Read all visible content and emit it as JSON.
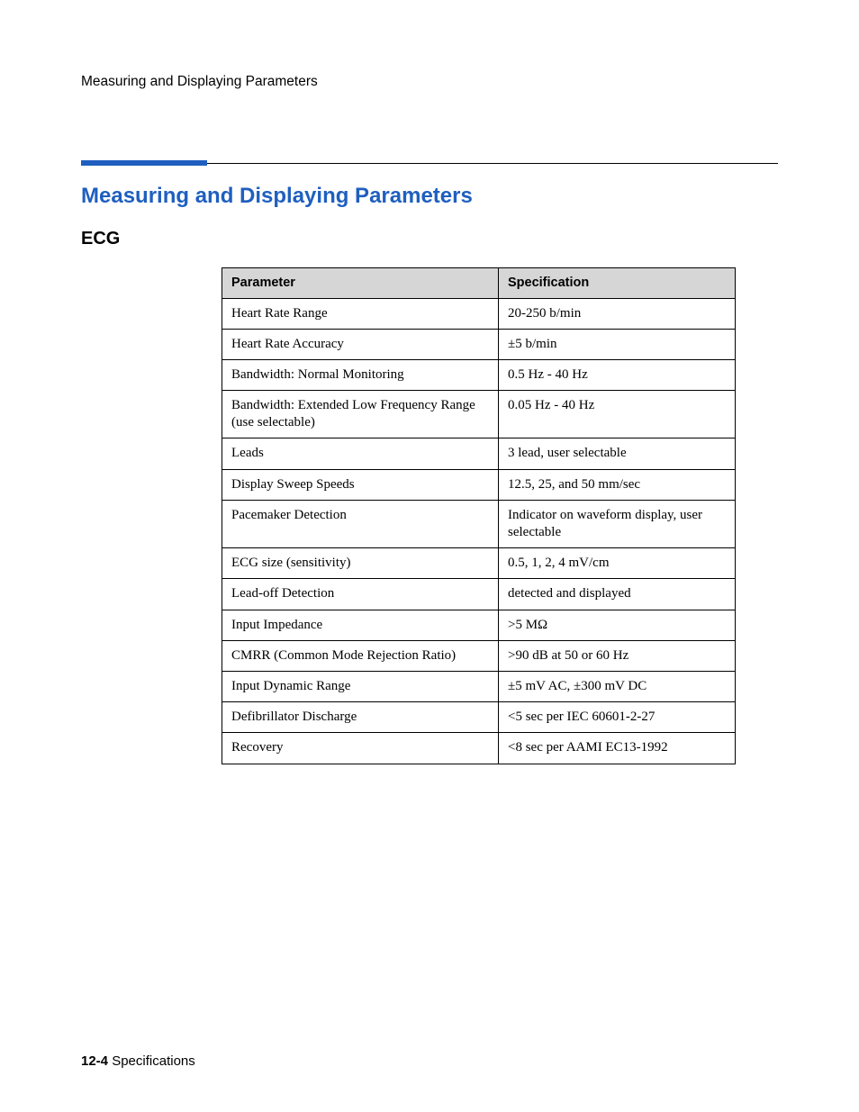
{
  "runningHeader": "Measuring and Displaying Parameters",
  "sectionHeading": "Measuring and Displaying Parameters",
  "subHeading": "ECG",
  "table": {
    "headers": {
      "col1": "Parameter",
      "col2": "Specification"
    },
    "rows": [
      {
        "param": "Heart Rate Range",
        "spec": "20-250 b/min"
      },
      {
        "param": "Heart Rate Accuracy",
        "spec": "±5 b/min"
      },
      {
        "param": "Bandwidth: Normal Monitoring",
        "spec": "0.5 Hz - 40 Hz"
      },
      {
        "param": "Bandwidth: Extended Low Frequency Range (use selectable)",
        "spec": "0.05 Hz - 40 Hz"
      },
      {
        "param": "Leads",
        "spec": "3 lead, user selectable"
      },
      {
        "param": "Display Sweep Speeds",
        "spec": "12.5, 25, and 50 mm/sec"
      },
      {
        "param": "Pacemaker Detection",
        "spec": "Indicator on waveform display, user selectable"
      },
      {
        "param": "ECG size (sensitivity)",
        "spec": "0.5, 1, 2, 4 mV/cm"
      },
      {
        "param": "Lead-off Detection",
        "spec": "detected and displayed"
      },
      {
        "param": "Input Impedance",
        "spec": ">5 MΩ"
      },
      {
        "param": "CMRR (Common Mode Rejection Ratio)",
        "spec": ">90 dB at 50 or 60 Hz"
      },
      {
        "param": "Input Dynamic Range",
        "spec": "±5 mV AC, ±300 mV DC"
      },
      {
        "param": "Defibrillator Discharge",
        "spec": "<5 sec per IEC 60601-2-27"
      },
      {
        "param": "Recovery",
        "spec": "<8 sec per AAMI EC13-1992"
      }
    ]
  },
  "footer": {
    "pageNumber": "12-4",
    "section": " Specifications"
  }
}
